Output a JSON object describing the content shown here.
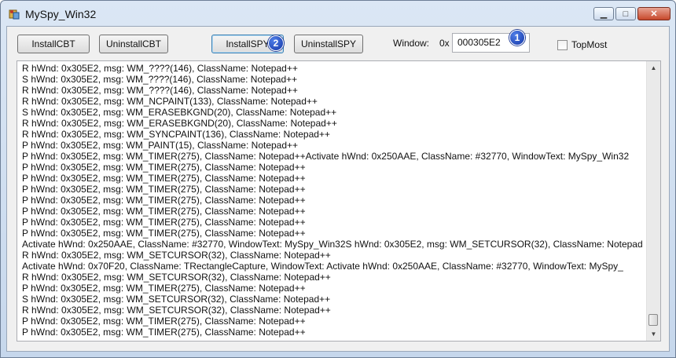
{
  "window": {
    "title": "MySpy_Win32"
  },
  "toolbar": {
    "install_cbt": "InstallCBT",
    "uninstall_cbt": "UninstallCBT",
    "install_spy": "InstallSPY",
    "uninstall_spy": "UninstallSPY",
    "window_label": "Window:",
    "hex_prefix": "0x",
    "hwnd_value": "000305E2",
    "topmost_label": "TopMost",
    "badge_1": "1",
    "badge_2": "2"
  },
  "log": [
    "R hWnd: 0x305E2, msg: WM_????(146), ClassName: Notepad++",
    "S hWnd: 0x305E2, msg: WM_????(146), ClassName: Notepad++",
    "R hWnd: 0x305E2, msg: WM_????(146), ClassName: Notepad++",
    "R hWnd: 0x305E2, msg: WM_NCPAINT(133), ClassName: Notepad++",
    "S hWnd: 0x305E2, msg: WM_ERASEBKGND(20), ClassName: Notepad++",
    "R hWnd: 0x305E2, msg: WM_ERASEBKGND(20), ClassName: Notepad++",
    "R hWnd: 0x305E2, msg: WM_SYNCPAINT(136), ClassName: Notepad++",
    "P hWnd: 0x305E2, msg: WM_PAINT(15), ClassName: Notepad++",
    "P hWnd: 0x305E2, msg: WM_TIMER(275), ClassName: Notepad++Activate hWnd: 0x250AAE, ClassName: #32770, WindowText: MySpy_Win32",
    "P hWnd: 0x305E2, msg: WM_TIMER(275), ClassName: Notepad++",
    "P hWnd: 0x305E2, msg: WM_TIMER(275), ClassName: Notepad++",
    "P hWnd: 0x305E2, msg: WM_TIMER(275), ClassName: Notepad++",
    "P hWnd: 0x305E2, msg: WM_TIMER(275), ClassName: Notepad++",
    "P hWnd: 0x305E2, msg: WM_TIMER(275), ClassName: Notepad++",
    "P hWnd: 0x305E2, msg: WM_TIMER(275), ClassName: Notepad++",
    "P hWnd: 0x305E2, msg: WM_TIMER(275), ClassName: Notepad++",
    "Activate hWnd: 0x250AAE, ClassName: #32770, WindowText: MySpy_Win32S hWnd: 0x305E2, msg: WM_SETCURSOR(32), ClassName: Notepad",
    "R hWnd: 0x305E2, msg: WM_SETCURSOR(32), ClassName: Notepad++",
    "Activate hWnd: 0x70F20, ClassName: TRectangleCapture, WindowText: Activate hWnd: 0x250AAE, ClassName: #32770, WindowText: MySpy_",
    "R hWnd: 0x305E2, msg: WM_SETCURSOR(32), ClassName: Notepad++",
    "P hWnd: 0x305E2, msg: WM_TIMER(275), ClassName: Notepad++",
    "S hWnd: 0x305E2, msg: WM_SETCURSOR(32), ClassName: Notepad++",
    "R hWnd: 0x305E2, msg: WM_SETCURSOR(32), ClassName: Notepad++",
    "P hWnd: 0x305E2, msg: WM_TIMER(275), ClassName: Notepad++",
    "P hWnd: 0x305E2, msg: WM_TIMER(275), ClassName: Notepad++"
  ]
}
